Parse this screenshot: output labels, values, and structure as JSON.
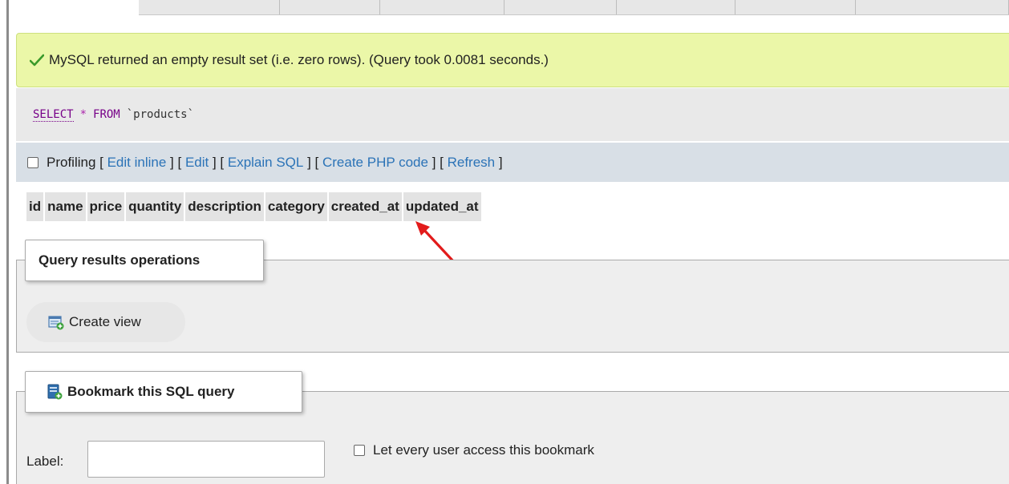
{
  "message": {
    "text": "MySQL returned an empty result set (i.e. zero rows). (Query took 0.0081 seconds.)"
  },
  "query": {
    "select": "SELECT",
    "star": "*",
    "from": "FROM",
    "table": "`products`"
  },
  "profiling": {
    "label": "Profiling",
    "links": [
      "Edit inline",
      "Edit",
      "Explain SQL",
      "Create PHP code",
      "Refresh"
    ]
  },
  "columns": [
    "id",
    "name",
    "price",
    "quantity",
    "description",
    "category",
    "created_at",
    "updated_at"
  ],
  "query_results_operations": {
    "legend": "Query results operations",
    "create_view": "Create view"
  },
  "bookmark": {
    "legend": "Bookmark this SQL query",
    "label": "Label:",
    "input_value": "",
    "access_label": "Let every user access this bookmark"
  },
  "colors": {
    "success_bg": "#ebf7a8",
    "link": "#2b73b7",
    "arrow": "#e21b1b"
  }
}
